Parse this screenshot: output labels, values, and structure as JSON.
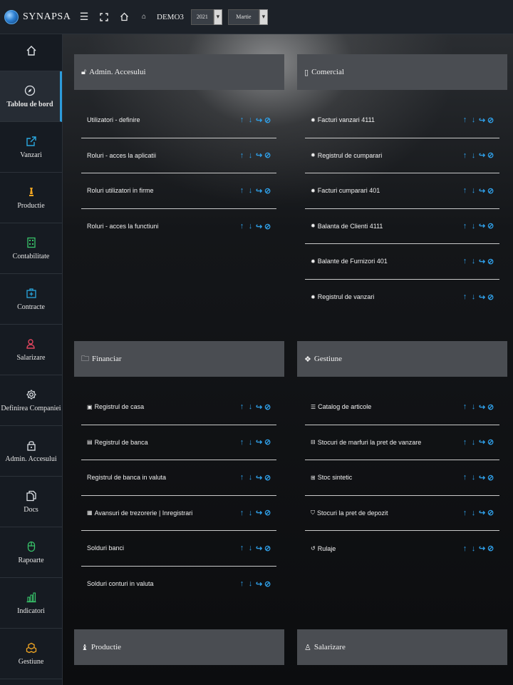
{
  "app": {
    "name": "SYNAPSA"
  },
  "topbar": {
    "company": "DEMO3",
    "year": "2021",
    "month": "Martie"
  },
  "sidebar": {
    "items": [
      {
        "label": "",
        "icon": "home-icon"
      },
      {
        "label": "Tablou de bord",
        "icon": "compass-icon"
      },
      {
        "label": "Vanzari",
        "icon": "share-icon"
      },
      {
        "label": "Productie",
        "icon": "chess-piece-icon"
      },
      {
        "label": "Contabilitate",
        "icon": "calculator-icon"
      },
      {
        "label": "Contracte",
        "icon": "medkit-icon"
      },
      {
        "label": "Salarizare",
        "icon": "people-icon"
      },
      {
        "label": "Definirea Companiei",
        "icon": "gear-icon"
      },
      {
        "label": "Admin. Accesului",
        "icon": "lock-icon"
      },
      {
        "label": "Docs",
        "icon": "copy-icon"
      },
      {
        "label": "Rapoarte",
        "icon": "mouse-icon"
      },
      {
        "label": "Indicatori",
        "icon": "bar-chart-icon"
      },
      {
        "label": "Gestiune",
        "icon": "cubes-icon"
      }
    ]
  },
  "panels": {
    "admin": {
      "title": "Admin. Accesului",
      "rows": [
        {
          "label": "Utilizatori - definire"
        },
        {
          "label": "Roluri - acces la aplicatii"
        },
        {
          "label": "Roluri utilizatori in firme"
        },
        {
          "label": "Roluri - acces la functiuni"
        }
      ]
    },
    "comercial": {
      "title": "Comercial",
      "rows": [
        {
          "label": "Facturi vanzari 4111"
        },
        {
          "label": "Registrul de cumparari"
        },
        {
          "label": "Facturi cumparari 401"
        },
        {
          "label": "Balanta de Clienti 4111"
        },
        {
          "label": "Balante de Furnizori 401"
        },
        {
          "label": "Registrul de vanzari"
        }
      ]
    },
    "financiar": {
      "title": "Financiar",
      "rows": [
        {
          "label": "Registrul de casa"
        },
        {
          "label": "Registrul de banca"
        },
        {
          "label": "Registrul de banca in valuta"
        },
        {
          "label": "Avansuri de trezorerie | Inregistrari"
        },
        {
          "label": "Solduri banci"
        },
        {
          "label": "Solduri conturi in valuta"
        }
      ]
    },
    "gestiune": {
      "title": "Gestiune",
      "rows": [
        {
          "label": "Catalog de articole"
        },
        {
          "label": "Stocuri de marfuri la pret de vanzare"
        },
        {
          "label": "Stoc sintetic"
        },
        {
          "label": "Stocuri la pret de depozit"
        },
        {
          "label": "Rulaje"
        }
      ]
    },
    "productie": {
      "title": "Productie"
    },
    "salarizare": {
      "title": "Salarizare"
    }
  },
  "colors": {
    "accent": "#2d9cdb",
    "action_icons": "#2f9ee6",
    "panel_header": "#4a4d52"
  }
}
